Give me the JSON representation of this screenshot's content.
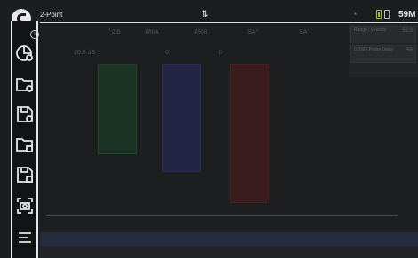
{
  "status": {
    "mode_label": "2-Point",
    "sync_icon": "sync-arrows-icon",
    "storage": "59M"
  },
  "sidebar": {
    "items": [
      {
        "name": "calibration-wizard-icon"
      },
      {
        "name": "open-setup-folder-icon"
      },
      {
        "name": "save-setup-icon"
      },
      {
        "name": "open-data-folder-icon"
      },
      {
        "name": "save-data-icon"
      },
      {
        "name": "screenshot-icon"
      },
      {
        "name": "menu-icon"
      }
    ]
  },
  "toolbar": {
    "items": [
      "/ 2.5",
      "A%A",
      "A%B",
      "SA^",
      "SA^"
    ]
  },
  "fields": {
    "gain": "20.0 dB",
    "field2": "0",
    "field3": "0"
  },
  "right_panel": {
    "box1_label": "Range / Velocity",
    "box1_value": "58.0",
    "box2_label": "0.000 / Probe Delay",
    "box2_value": "58"
  },
  "chart_data": {
    "type": "bar",
    "gates": [
      "gate-A",
      "gate-B",
      "gate-I"
    ],
    "colors": [
      "#1c3426",
      "#232444",
      "#3a1c1e"
    ]
  }
}
